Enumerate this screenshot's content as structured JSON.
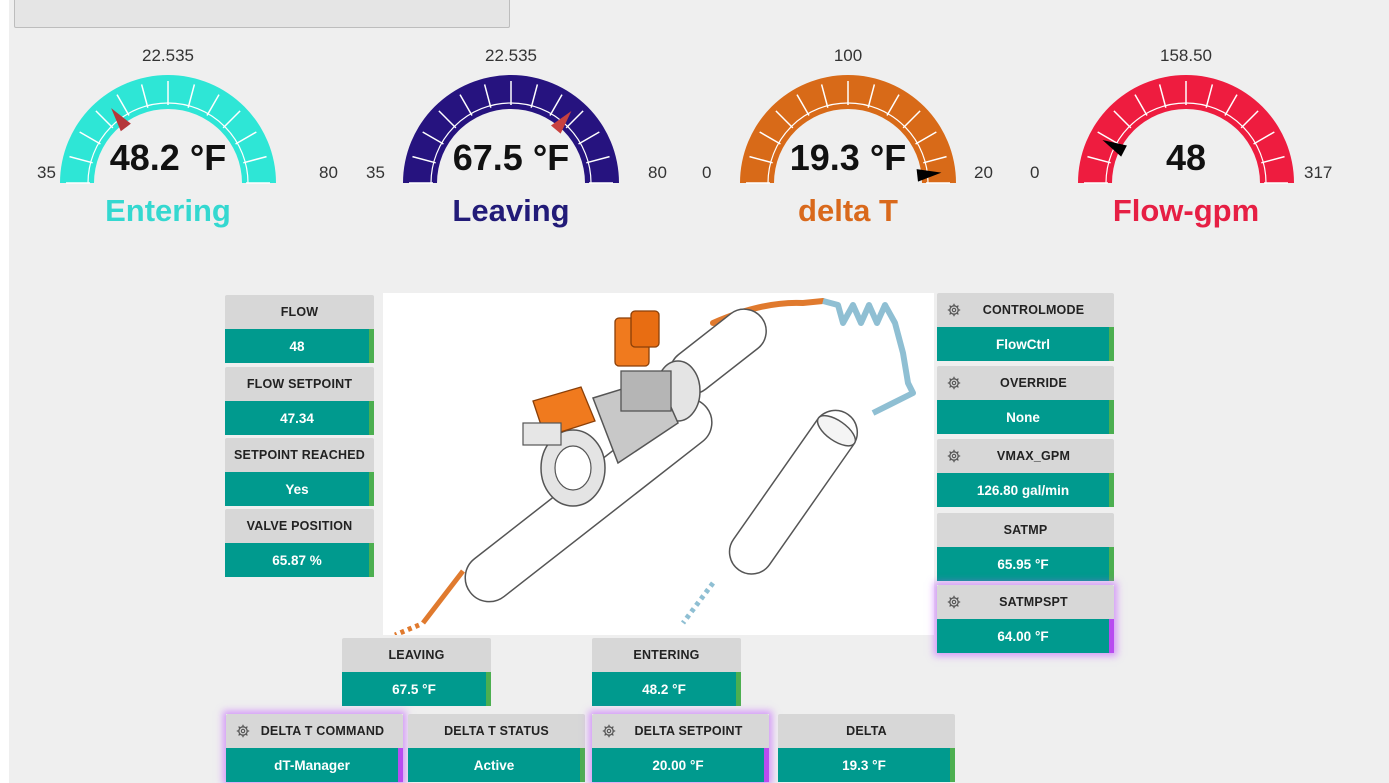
{
  "gauges": [
    {
      "label": "Entering",
      "value": "48.2 °F",
      "min": "35",
      "max": "80",
      "top": "22.535",
      "color": "#2ee6d6",
      "label_color": "#34d8d0",
      "needle": "#b5373a"
    },
    {
      "label": "Leaving",
      "value": "67.5 °F",
      "min": "35",
      "max": "80",
      "top": "22.535",
      "color": "#26137f",
      "label_color": "#221b78",
      "needle": "#c8413f"
    },
    {
      "label": "delta T",
      "value": "19.3 °F",
      "min": "0",
      "max": "20",
      "top": "100",
      "color": "#d86a18",
      "label_color": "#d9691c",
      "needle": "#000000"
    },
    {
      "label": "Flow-gpm",
      "value": "48",
      "min": "0",
      "max": "317",
      "top": "158.50",
      "color": "#ee1c3f",
      "label_color": "#e61f44",
      "needle": "#000000"
    }
  ],
  "left_panel": [
    {
      "label": "FLOW",
      "value": "48"
    },
    {
      "label": "FLOW SETPOINT",
      "value": "47.34"
    },
    {
      "label": "SETPOINT REACHED",
      "value": "Yes"
    },
    {
      "label": "VALVE POSITION",
      "value": "65.87 %"
    }
  ],
  "right_panel": [
    {
      "label": "CONTROLMODE",
      "value": "FlowCtrl"
    },
    {
      "label": "OVERRIDE",
      "value": "None"
    },
    {
      "label": "VMAX_GPM",
      "value": "126.80 gal/min"
    },
    {
      "label": "SATMP",
      "value": "65.95 °F"
    },
    {
      "label": "SATMPSPT",
      "value": "64.00 °F"
    }
  ],
  "middle_panel": [
    {
      "label": "LEAVING",
      "value": "67.5 °F"
    },
    {
      "label": "ENTERING",
      "value": "48.2 °F"
    }
  ],
  "bottom_panel": [
    {
      "label": "DELTA T COMMAND",
      "value": "dT-Manager"
    },
    {
      "label": "DELTA T STATUS",
      "value": "Active"
    },
    {
      "label": "DELTA SETPOINT",
      "value": "20.00 °F"
    },
    {
      "label": "DELTA",
      "value": "19.3 °F"
    }
  ],
  "colors": {
    "value_bg": "#009a8e",
    "label_bg": "#d7d7d7",
    "status_bar": "#4caf50",
    "highlight_glow": "#be50ff",
    "pipe_hot": "#e07a2e",
    "pipe_cold": "#8fbfd3"
  }
}
